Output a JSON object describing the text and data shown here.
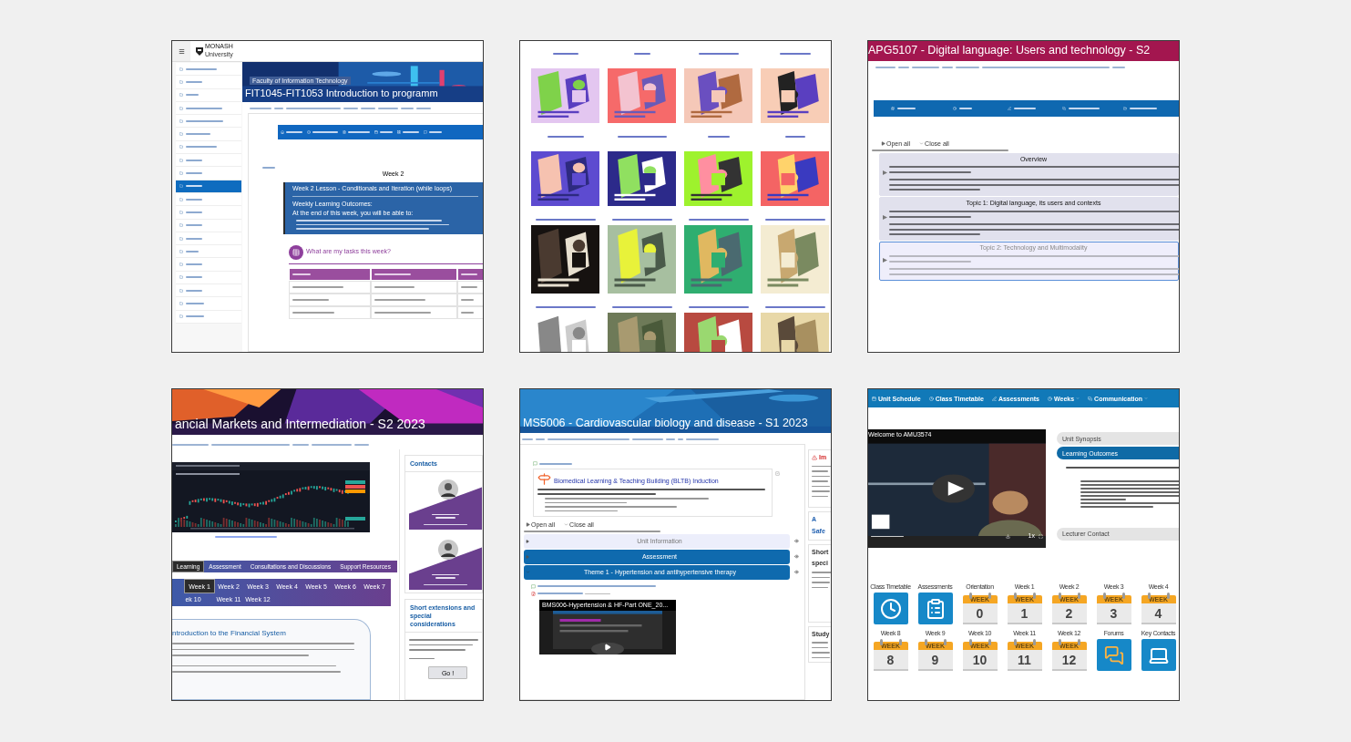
{
  "programming_unit": {
    "logo": [
      "MONASH",
      "University"
    ],
    "sidebar": [
      {
        "selected": false
      },
      {
        "selected": false
      },
      {
        "selected": false
      },
      {
        "selected": false
      },
      {
        "selected": false
      },
      {
        "selected": false
      },
      {
        "selected": false
      },
      {
        "selected": false
      },
      {
        "selected": false
      },
      {
        "selected": true
      },
      {
        "selected": false
      },
      {
        "selected": false
      },
      {
        "selected": false
      },
      {
        "selected": false
      },
      {
        "selected": false
      },
      {
        "selected": false
      },
      {
        "selected": false
      },
      {
        "selected": false
      },
      {
        "selected": false
      },
      {
        "selected": false
      }
    ],
    "faculty": "Faculty of Information Technology",
    "title": "FIT1045-FIT1053 Introduction to programm",
    "heading": "Week 2",
    "lesson": {
      "title": "Week 2 Lesson - Conditionals and Iteration (while loops)",
      "outcomes_heading": "Weekly Learning Outcomes:",
      "intro": "At the end of this week, you will be able to:"
    },
    "tasks_heading": "What are my tasks this week?"
  },
  "language_unit": {
    "title": "APG5107 - Digital language: Users and technology - S2",
    "open_all": "Open all",
    "close_all": "Close all",
    "sections": [
      {
        "title": "Overview",
        "highlighted": false
      },
      {
        "title": "Topic 1: Digital language, its users and contexts",
        "highlighted": false
      },
      {
        "title": "Topic 2: Technology and Multimodality",
        "highlighted": true
      }
    ]
  },
  "finance_unit": {
    "title": "ancial Markets and Intermediation - S2 2023",
    "tabs": [
      {
        "label": "Learning",
        "selected": true
      },
      {
        "label": "Assessment",
        "selected": false
      },
      {
        "label": "Consultations and Discussions",
        "selected": false
      },
      {
        "label": "Support Resources",
        "selected": false
      }
    ],
    "weeks": [
      {
        "label": "Week 1",
        "selected": true
      },
      {
        "label": "Week 2",
        "selected": false
      },
      {
        "label": "Week 3",
        "selected": false
      },
      {
        "label": "Week 4",
        "selected": false
      },
      {
        "label": "Week 5",
        "selected": false
      },
      {
        "label": "Week 6",
        "selected": false
      },
      {
        "label": "Week 7",
        "selected": false
      },
      {
        "label": "ek 10",
        "selected": false
      },
      {
        "label": "Week 11",
        "selected": false
      },
      {
        "label": "Week 12",
        "selected": false
      }
    ],
    "topic_title": "ntroduction to the Financial System",
    "contacts_heading": "Contacts",
    "contacts": [
      {
        "kind": "profile"
      },
      {
        "kind": "profile"
      }
    ],
    "extensions": {
      "heading": "Short extensions and special considerations",
      "button": "Go !"
    }
  },
  "biomed_unit": {
    "title": "MS5006 - Cardiovascular biology and disease - S1 2023",
    "announcement_title": "Biomedical Learning & Teaching Building (BLTB) Induction",
    "open_all": "Open all",
    "close_all": "Close all",
    "sections": [
      {
        "title": "Unit Information",
        "kind": "muted",
        "expanded": false
      },
      {
        "title": "Assessment",
        "kind": "primary",
        "expanded": false
      },
      {
        "title": "Theme 1 - Hypertension and antihypertensive therapy",
        "kind": "primary",
        "expanded": true
      }
    ],
    "video_title": "BMS006-Hypertension & HF-Part ONE_20...",
    "side_panels": [
      [
        "Im"
      ],
      [
        "A",
        "Safe"
      ],
      [
        "Short",
        "speci"
      ],
      [
        "Study"
      ]
    ]
  },
  "masculinities_unit": {
    "nav": [
      "Unit Schedule",
      "Class Timetable",
      "Assessments",
      "Weeks",
      "Communication"
    ],
    "video": {
      "title": "Welcome to AMU3574",
      "speed": "1x"
    },
    "accordion": [
      {
        "title": "Unit Synopsis",
        "expanded": false
      },
      {
        "title": "Learning Outcomes",
        "expanded": true
      },
      {
        "title": "Lecturer Contact",
        "expanded": false
      }
    ],
    "tiles": [
      {
        "label": "Class Timetable",
        "kind": "timetable"
      },
      {
        "label": "Assessments",
        "kind": "assessments"
      },
      {
        "label": "Orientation",
        "kind": "week",
        "badge": "WEEK",
        "number": "0"
      },
      {
        "label": "Week 1",
        "kind": "week",
        "badge": "WEEK",
        "number": "1"
      },
      {
        "label": "Week 2",
        "kind": "week",
        "badge": "WEEK",
        "number": "2"
      },
      {
        "label": "Week 3",
        "kind": "week",
        "badge": "WEEK",
        "number": "3"
      },
      {
        "label": "Week 4",
        "kind": "week",
        "badge": "WEEK",
        "number": "4"
      },
      {
        "label": "Week 8",
        "kind": "week",
        "badge": "WEEK",
        "number": "8"
      },
      {
        "label": "Week 9",
        "kind": "week",
        "badge": "WEEK",
        "number": "9"
      },
      {
        "label": "Week 10",
        "kind": "week",
        "badge": "WEEK",
        "number": "10"
      },
      {
        "label": "Week 11",
        "kind": "week",
        "badge": "WEEK",
        "number": "11"
      },
      {
        "label": "Week 12",
        "kind": "week",
        "badge": "WEEK",
        "number": "12"
      },
      {
        "label": "Forums",
        "kind": "forums"
      },
      {
        "label": "Key Contacts",
        "kind": "contacts"
      }
    ]
  }
}
